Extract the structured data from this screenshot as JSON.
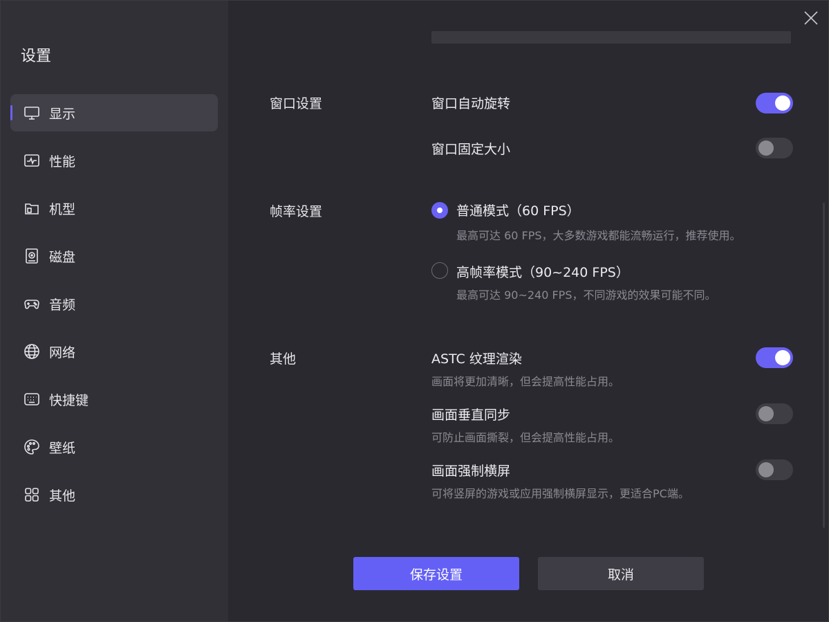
{
  "sidebar": {
    "title": "设置",
    "items": [
      {
        "label": "显示",
        "icon": "monitor-icon",
        "active": true
      },
      {
        "label": "性能",
        "icon": "performance-icon"
      },
      {
        "label": "机型",
        "icon": "device-model-icon"
      },
      {
        "label": "磁盘",
        "icon": "disk-icon"
      },
      {
        "label": "音频",
        "icon": "gamepad-icon"
      },
      {
        "label": "网络",
        "icon": "globe-icon"
      },
      {
        "label": "快捷键",
        "icon": "keyboard-icon"
      },
      {
        "label": "壁纸",
        "icon": "palette-icon"
      },
      {
        "label": "其他",
        "icon": "grid-icon"
      }
    ]
  },
  "window_settings": {
    "label": "窗口设置",
    "auto_rotate": {
      "title": "窗口自动旋转",
      "enabled": true
    },
    "fixed_size": {
      "title": "窗口固定大小",
      "enabled": false
    }
  },
  "frame_rate": {
    "label": "帧率设置",
    "normal": {
      "title": "普通模式（60 FPS）",
      "desc": "最高可达 60 FPS，大多数游戏都能流畅运行，推荐使用。",
      "selected": true
    },
    "high": {
      "title": "高帧率模式（90~240 FPS）",
      "desc": "最高可达 90~240 FPS，不同游戏的效果可能不同。",
      "selected": false
    }
  },
  "other": {
    "label": "其他",
    "astc": {
      "title": "ASTC 纹理渲染",
      "desc": "画面将更加清晰，但会提高性能占用。",
      "enabled": true
    },
    "vsync": {
      "title": "画面垂直同步",
      "desc": "可防止画面撕裂，但会提高性能占用。",
      "enabled": false
    },
    "landscape": {
      "title": "画面强制横屏",
      "desc": "可将竖屏的游戏或应用强制横屏显示，更适合PC端。",
      "enabled": false
    }
  },
  "footer": {
    "save_label": "保存设置",
    "cancel_label": "取消"
  },
  "colors": {
    "accent": "#6a62f5",
    "sidebar_bg": "#313036",
    "main_bg": "#2a292f"
  }
}
